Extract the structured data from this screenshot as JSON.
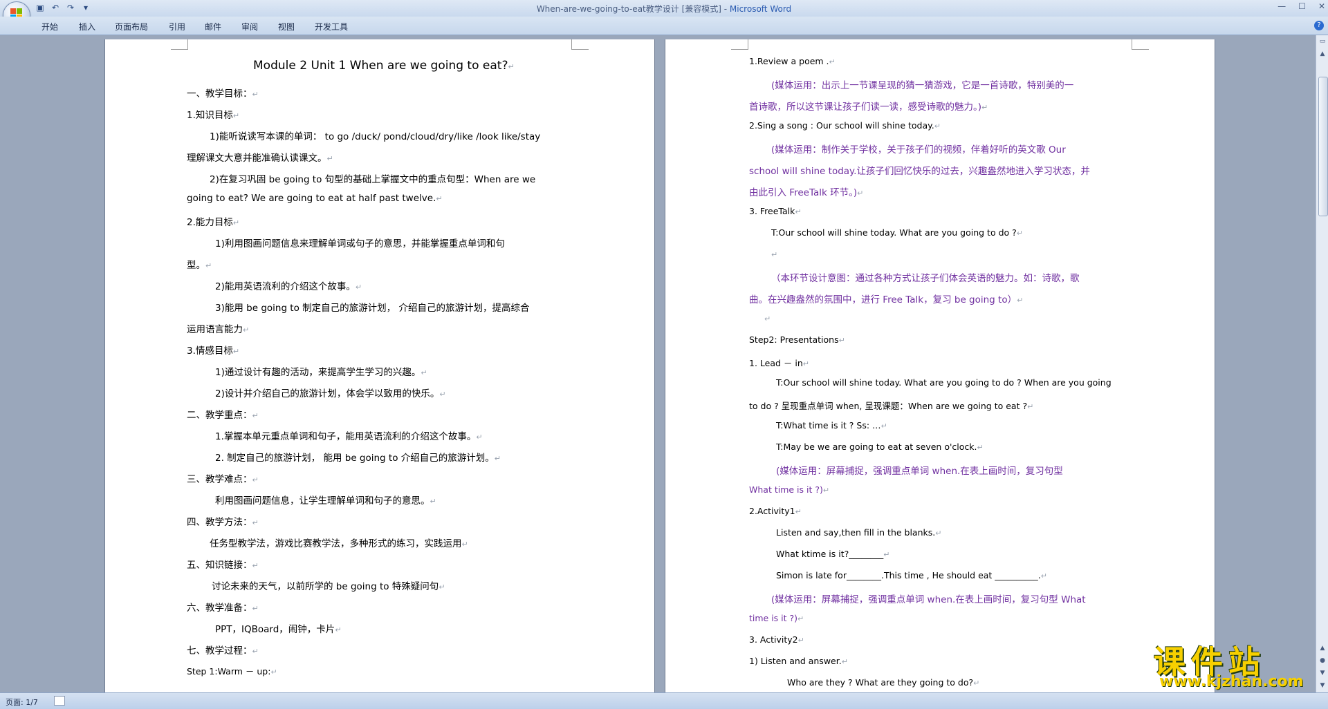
{
  "window": {
    "title": "When-are-we-going-to-eat教学设计 [兼容模式] - ",
    "app_name": "Microsoft Word",
    "controls": [
      "—",
      "☐",
      "✕"
    ]
  },
  "ribbon": {
    "tabs": [
      "开始",
      "插入",
      "页面布局",
      "引用",
      "邮件",
      "审阅",
      "视图",
      "开发工具"
    ]
  },
  "status_bar": {
    "page_info": "页面: 1/7"
  },
  "watermark": {
    "cn": "课件站",
    "en": "www.kjzhan.com"
  },
  "page1": [
    "Module 2 Unit 1 When are we going to eat?",
    "一、教学目标：",
    "1.知识目标",
    "1)能听说读写本课的单词： to go /duck/ pond/cloud/dry/like /look like/stay",
    "理解课文大意并能准确认读课文。",
    "2)在复习巩固 be going to 句型的基础上掌握文中的重点句型：When are we",
    "going to eat? We are going to eat at half past twelve.",
    "2.能力目标",
    "1)利用图画问题信息来理解单词或句子的意思，并能掌握重点单词和句",
    "型。",
    "2)能用英语流利的介绍这个故事。",
    "3)能用 be going to 制定自己的旅游计划， 介绍自己的旅游计划，提高综合",
    "运用语言能力",
    "3.情感目标",
    "1)通过设计有趣的活动，来提高学生学习的兴趣。",
    "2)设计并介绍自己的旅游计划，体会学以致用的快乐。",
    "二、教学重点：",
    "1.掌握本单元重点单词和句子，能用英语流利的介绍这个故事。",
    "2. 制定自己的旅游计划， 能用 be going to 介绍自己的旅游计划。",
    "三、教学难点：",
    "利用图画问题信息，让学生理解单词和句子的意思。",
    "四、教学方法：",
    "任务型教学法，游戏比赛教学法，多种形式的练习，实践运用",
    "五、知识链接：",
    "讨论未来的天气，以前所学的 be going to 特殊疑问句",
    "六、教学准备：",
    "PPT，IQBoard，闹钟，卡片",
    "七、教学过程：",
    "Step 1:Warm － up:"
  ],
  "page2": [
    "1.Review a poem .",
    "(媒体运用：出示上一节课呈现的猜一猜游戏，它是一首诗歌，特别美的一",
    "首诗歌，所以这节课让孩子们读一读，感受诗歌的魅力。)",
    "2.Sing a song : Our school will shine today.",
    "(媒体运用：制作关于学校，关于孩子们的视频，伴着好听的英文歌 Our",
    "school will shine today.让孩子们回忆快乐的过去，兴趣盎然地进入学习状态，并",
    "由此引入 FreeTalk 环节。)",
    "3. FreeTalk",
    "T:Our school will shine today. What are you going to do ?",
    "",
    "（本环节设计意图：通过各种方式让孩子们体会英语的魅力。如：诗歌，歌",
    "曲。在兴趣盎然的氛围中，进行 Free Talk，复习 be going to）",
    "",
    "Step2: Presentations",
    "1.    Lead － in",
    "T:Our school will shine today. What are you going to do ? When are you going",
    "to do ? 呈现重点单词 when, 呈现课题：When are we going to eat ?",
    "T:What time is it ?   Ss: …",
    "T:May be we are going to eat at seven o'clock.",
    "(媒体运用：屏幕捕捉，强调重点单词  when.在表上画时间，复习句型",
    "What time is it ?)",
    "2.Activity1",
    "Listen and say,then fill in the blanks.",
    "What ktime is it?________",
    "Simon is late for________.This time , He should  eat __________.",
    "(媒体运用：屏幕捕捉，强调重点单词 when.在表上画时间，复习句型 What",
    "time is it ?)",
    "3. Activity2",
    "1) Listen and answer.",
    "Who are they ? What are they going to do?"
  ]
}
